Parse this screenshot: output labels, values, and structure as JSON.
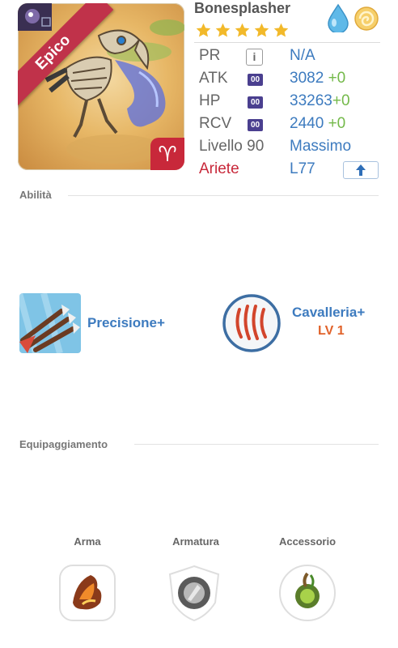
{
  "monster": {
    "name": "Bonesplasher",
    "rarity": "Epico",
    "stars": 5,
    "elements": [
      "water-drop-icon",
      "wind-swirl-icon"
    ],
    "zodiac_symbol": "♈"
  },
  "stats": {
    "pr": {
      "label": "PR",
      "icon": "i",
      "value": "N/A"
    },
    "atk": {
      "label": "ATK",
      "badge": "00",
      "value": "3082",
      "bonus": "+0"
    },
    "hp": {
      "label": "HP",
      "badge": "00",
      "value": "33263",
      "bonus": "+0"
    },
    "rcv": {
      "label": "RCV",
      "badge": "00",
      "value": "2440",
      "bonus": "+0"
    },
    "level": {
      "label": "Livello 90",
      "value": "Massimo"
    },
    "sign": {
      "label": "Ariete",
      "value": "L77"
    }
  },
  "sections": {
    "abilities": "Abilità",
    "equipment": "Equipaggiamento"
  },
  "abilities": [
    {
      "name": "Precisione+",
      "level": ""
    },
    {
      "name": "Cavalleria+",
      "level": "LV 1"
    }
  ],
  "equipment": [
    {
      "label": "Arma",
      "icon": "weapon-icon"
    },
    {
      "label": "Armatura",
      "icon": "armor-icon"
    },
    {
      "label": "Accessorio",
      "icon": "accessory-icon"
    }
  ],
  "colors": {
    "value_blue": "#3d7bbf",
    "bonus_green": "#74b94a",
    "rarity_red": "#c0324a",
    "level_orange": "#e1622a"
  }
}
